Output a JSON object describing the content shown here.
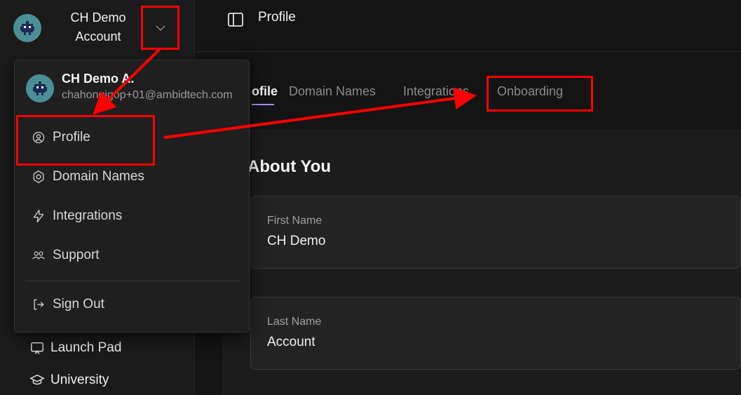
{
  "account": {
    "name_line1": "CH Demo",
    "name_line2": "Account"
  },
  "sidebar": {
    "bottom_items": [
      {
        "label": "Launch Pad",
        "icon": "launch-pad-icon"
      },
      {
        "label": "University",
        "icon": "graduation-cap-icon"
      }
    ]
  },
  "topbar": {
    "title": "Profile",
    "icon": "sidebar-panel-icon"
  },
  "tabs": [
    {
      "label": "ofile",
      "active": true
    },
    {
      "label": "Domain Names",
      "active": false
    },
    {
      "label": "Integrations",
      "active": false
    },
    {
      "label": "Onboarding",
      "active": false
    }
  ],
  "profile_section": {
    "title": "About You",
    "fields": [
      {
        "label": "First Name",
        "value": "CH Demo"
      },
      {
        "label": "Last Name",
        "value": "Account"
      }
    ]
  },
  "dropdown": {
    "user_name": "CH Demo A.",
    "user_email": "chahongigop+01@ambidtech.com",
    "items": [
      {
        "label": "Profile",
        "icon": "user-circle-icon"
      },
      {
        "label": "Domain Names",
        "icon": "gear-icon"
      },
      {
        "label": "Integrations",
        "icon": "lightning-icon"
      },
      {
        "label": "Support",
        "icon": "users-icon"
      }
    ],
    "sign_out": {
      "label": "Sign Out",
      "icon": "sign-out-icon"
    }
  },
  "colors": {
    "annotation": "#ff0000",
    "accent": "#a78bfa",
    "avatar_bg": "#4a8f96"
  }
}
